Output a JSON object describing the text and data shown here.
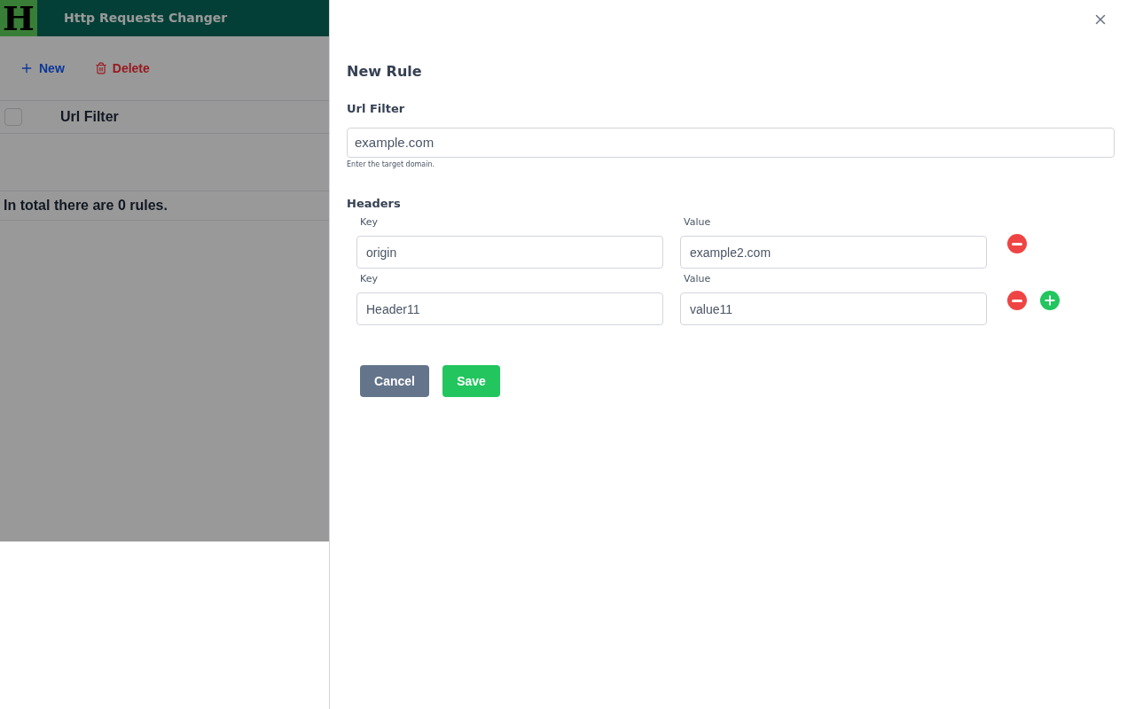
{
  "app": {
    "logo": "H",
    "title": "Http Requests Changer",
    "toolbar": [
      {
        "kind": "new",
        "label": "New"
      },
      {
        "kind": "delete",
        "label": "Delete"
      }
    ],
    "table": {
      "select_all": {
        "checked": false
      },
      "columns": [
        "Url Filter"
      ]
    },
    "footer": "In total there are 0 rules."
  },
  "drawer": {
    "title": "New Rule",
    "url_filter": {
      "label": "Url Filter",
      "value": "example.com",
      "hint": "Enter the target domain."
    },
    "headers": {
      "label": "Headers",
      "rows": [
        {
          "key_label": "Key",
          "key": "origin",
          "value_label": "Value",
          "value": "example2.com",
          "addable": false
        },
        {
          "key_label": "Key",
          "key": "Header11",
          "value_label": "Value",
          "value": "value11",
          "addable": true
        }
      ]
    },
    "buttons": [
      {
        "kind": "cancel",
        "label": "Cancel"
      },
      {
        "kind": "save",
        "label": "Save"
      }
    ]
  }
}
